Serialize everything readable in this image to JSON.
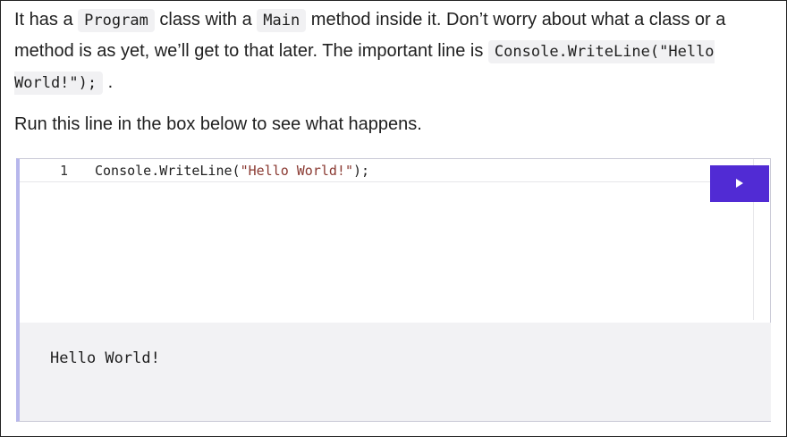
{
  "paragraph1": {
    "t1": "It has a ",
    "code1": "Program",
    "t2": " class with a ",
    "code2": "Main",
    "t3": " method inside it. Don’t worry about what a class or a method is as yet, we’ll get to that later. The important line is ",
    "code3": "Console.WriteLine(\"Hello World!\");",
    "t4": " ."
  },
  "paragraph2": {
    "text": "Run this line in the box below to see what happens."
  },
  "editor": {
    "line_number": "1",
    "code_prefix": "Console.WriteLine(",
    "code_string": "\"Hello World!\"",
    "code_suffix": ");",
    "run_icon": "play-icon",
    "run_color": "#512bd4",
    "output": "Hello World!"
  }
}
